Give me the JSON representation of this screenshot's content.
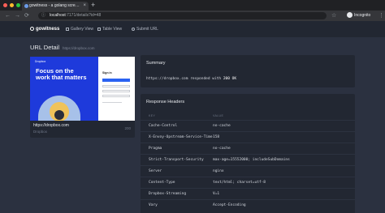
{
  "browser": {
    "tab_title": "gowitness - a golang scre…",
    "url_host": "localhost",
    "url_path": ":7171/details?id=48",
    "profile_label": "Incognito",
    "traffic_colors": [
      "#ff5f57",
      "#febc2e",
      "#28c840"
    ]
  },
  "nav": {
    "brand": "gowitness",
    "links": [
      "Gallery View",
      "Table View",
      "Submit URL"
    ]
  },
  "page": {
    "title": "URL Detail",
    "subtitle": "https://dropbox.com"
  },
  "screenshot": {
    "url": "https://dropbox.com",
    "title": "Dropbox",
    "code": "200",
    "preview": {
      "logo": "Dropbox",
      "headline": "Focus on the work that matters",
      "signin": "Sign in"
    }
  },
  "summary": {
    "heading": "Summary",
    "url": "https://dropbox.com",
    "text_mid": " responded with ",
    "code": "200 OK"
  },
  "headers": {
    "heading": "Response Headers",
    "col_key": "KEY",
    "col_value": "VALUE",
    "rows": [
      {
        "key": "Cache-Control",
        "value": "no-cache"
      },
      {
        "key": "X-Envoy-Upstream-Service-Time",
        "value": "158"
      },
      {
        "key": "Pragma",
        "value": "no-cache"
      },
      {
        "key": "Strict-Transport-Security",
        "value": "max-age=15552000; includeSubDomains"
      },
      {
        "key": "Server",
        "value": "nginx"
      },
      {
        "key": "Content-Type",
        "value": "text/html; charset=utf-8"
      },
      {
        "key": "Dropbox-Streaming",
        "value": "V=1"
      },
      {
        "key": "Vary",
        "value": "Accept-Encoding"
      }
    ]
  }
}
